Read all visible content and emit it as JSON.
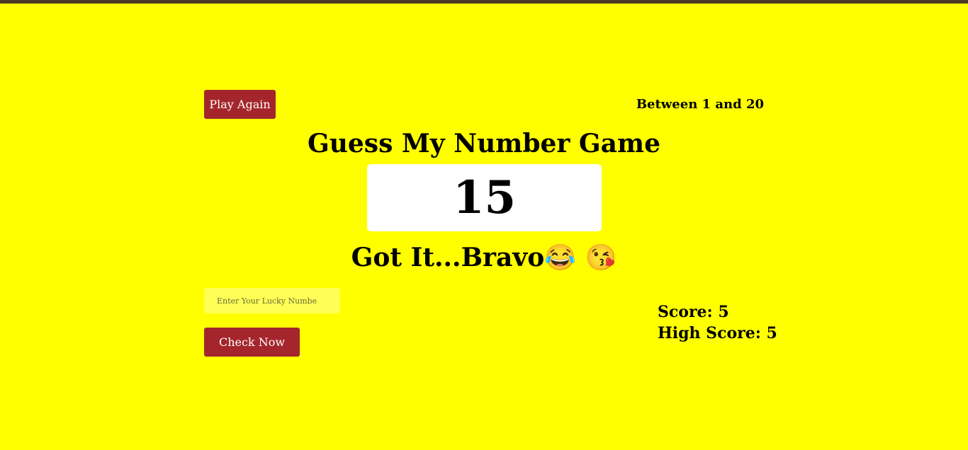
{
  "game": {
    "play_again_label": "Play Again",
    "range_text": "Between 1 and 20",
    "title": "Guess My Number Game",
    "secret_number": "15",
    "message": "Got It...Bravo😂 😘",
    "input_placeholder": "Enter Your Lucky Number",
    "input_value": "",
    "check_label": "Check Now",
    "score_label": "Score: 5",
    "high_score_label": "High Score: 5"
  },
  "colors": {
    "background": "#ffff00",
    "button": "#a4262c",
    "number_box": "#ffffff",
    "top_strip": "#4a3a26"
  }
}
